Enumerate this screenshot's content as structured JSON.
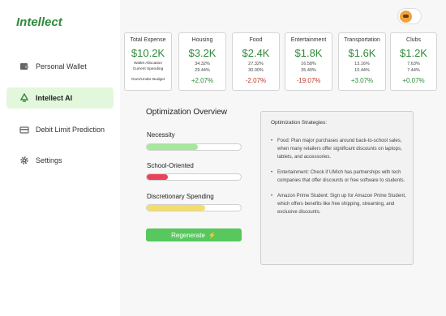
{
  "app": {
    "logo": "Intellect"
  },
  "sidebar": {
    "items": [
      {
        "label": "Personal Wallet",
        "icon": "wallet-icon",
        "active": false
      },
      {
        "label": "Intellect AI",
        "icon": "recycle-icon",
        "active": true
      },
      {
        "label": "Debit Limit Prediction",
        "icon": "credit-card-icon",
        "active": false
      },
      {
        "label": "Settings",
        "icon": "gear-icon",
        "active": false
      }
    ]
  },
  "header": {
    "avatar": "user-avatar"
  },
  "summary": {
    "total": {
      "title": "Total Expense",
      "value": "$10.2K",
      "label_allocation": "Wallet Allocation",
      "label_current": "Current Spending",
      "label_budget": "Over/Under Budget"
    },
    "categories": [
      {
        "title": "Housing",
        "value": "$3.2K",
        "allocation": "34.32%",
        "current": "29.44%",
        "change": "+2.07%",
        "direction": "up"
      },
      {
        "title": "Food",
        "value": "$2.4K",
        "allocation": "27.32%",
        "current": "30.00%",
        "change": "-2.07%",
        "direction": "down"
      },
      {
        "title": "Entertainment",
        "value": "$1.8K",
        "allocation": "16.58%",
        "current": "35.40%",
        "change": "-19.07%",
        "direction": "down"
      },
      {
        "title": "Transportation",
        "value": "$1.6K",
        "allocation": "13.16%",
        "current": "10.44%",
        "change": "+3.07%",
        "direction": "up"
      },
      {
        "title": "Clubs",
        "value": "$1.2K",
        "allocation": "7.63%",
        "current": "7.44%",
        "change": "+0.07%",
        "direction": "up"
      }
    ]
  },
  "optimization": {
    "title": "Optimization Overview",
    "bars": [
      {
        "label": "Necessity",
        "fill": 0.54,
        "color": "#a6e89a"
      },
      {
        "label": "School-Oriented",
        "fill": 0.22,
        "color": "#e8435a"
      },
      {
        "label": "Discretionary Spending",
        "fill": 0.62,
        "color": "#f5dd6a"
      }
    ],
    "button": "Regenerate",
    "button_icon": "lightning-icon"
  },
  "strategies": {
    "title": "Optimization Strategies:",
    "items": [
      "Food: Plan major purchases around back-to-school sales, when many retailers offer significant discounts on laptops, tablets, and accessories.",
      "Entertainment: Check if UMich has partnerships with tech companies that offer discounts or free software to students.",
      "Amazon Prime Student: Sign up for Amazon Prime Student, which offers benefits like free shipping, streaming, and exclusive discounts."
    ]
  },
  "colors": {
    "accent": "#2f8a39",
    "negative": "#c0392b",
    "active_nav": "#e3f7dc",
    "button": "#57c75e"
  }
}
